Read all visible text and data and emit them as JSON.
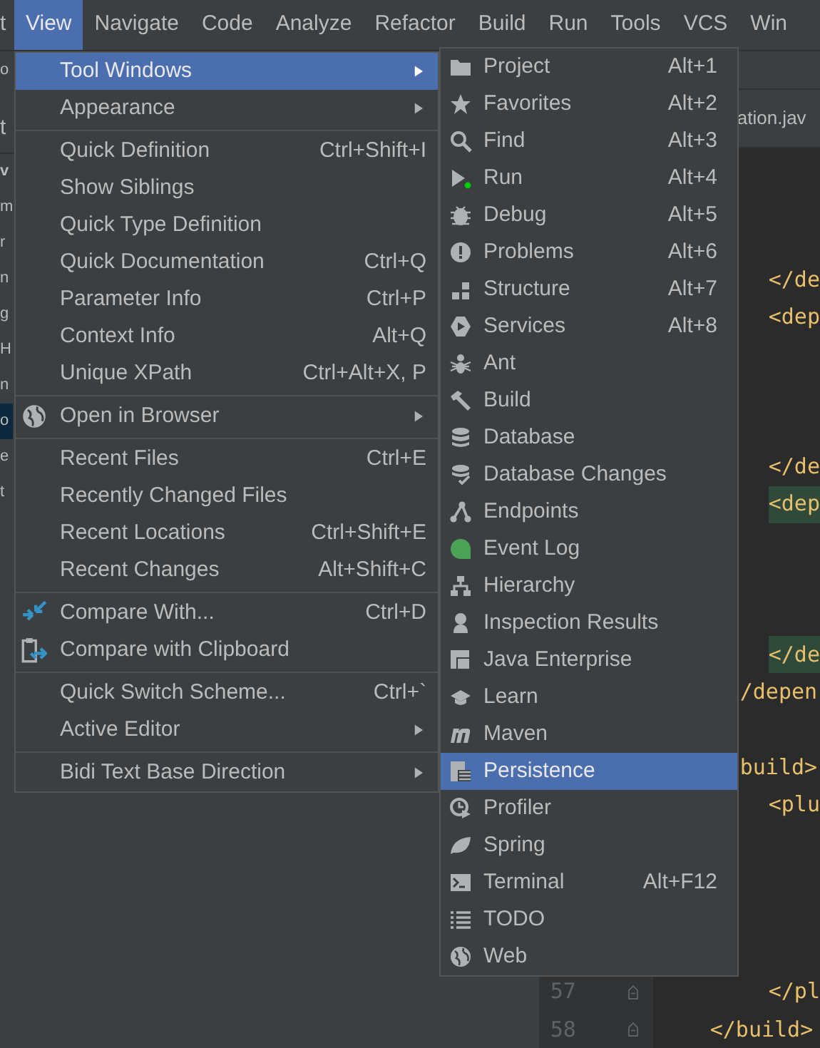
{
  "menu_bar": {
    "leading_fragment": "t",
    "items": [
      {
        "label": "View",
        "selected": true
      },
      {
        "label": "Navigate",
        "selected": false
      },
      {
        "label": "Code",
        "selected": false
      },
      {
        "label": "Analyze",
        "selected": false
      },
      {
        "label": "Refactor",
        "selected": false
      },
      {
        "label": "Build",
        "selected": false
      },
      {
        "label": "Run",
        "selected": false
      },
      {
        "label": "Tools",
        "selected": false
      },
      {
        "label": "VCS",
        "selected": false
      },
      {
        "label": "Win",
        "selected": false
      }
    ]
  },
  "project_panel": {
    "toolbar_fragment": "o",
    "tab_fragment": "t",
    "items": [
      {
        "text": "v",
        "bold": true,
        "selected": false
      },
      {
        "text": "m",
        "bold": false,
        "selected": false
      },
      {
        "text": "r",
        "bold": false,
        "selected": false
      },
      {
        "text": "n",
        "bold": false,
        "selected": false
      },
      {
        "text": "g",
        "bold": false,
        "selected": false
      },
      {
        "text": "H",
        "bold": false,
        "selected": false
      },
      {
        "text": "n",
        "bold": false,
        "selected": false
      },
      {
        "text": "o",
        "bold": false,
        "selected": true
      },
      {
        "text": "e",
        "bold": false,
        "selected": false
      },
      {
        "text": "t",
        "bold": false,
        "selected": false
      }
    ]
  },
  "editor": {
    "tab": "ation.jav",
    "lines": [
      {
        "text": "</de",
        "highlighted": false
      },
      {
        "text": "<dep",
        "highlighted": false
      },
      {
        "text": "</de",
        "highlighted": false
      },
      {
        "text": "<dep",
        "highlighted": true
      },
      {
        "text": "</de",
        "highlighted": true
      },
      {
        "text": "/depen",
        "highlighted": false
      },
      {
        "text": "build>",
        "highlighted": false
      },
      {
        "text": "<plu",
        "highlighted": false
      },
      {
        "number": "57",
        "text": "</pl",
        "highlighted": false
      },
      {
        "number": "58",
        "text": "</build>",
        "highlighted": false
      }
    ]
  },
  "view_menu": {
    "groups": [
      [
        {
          "label": "Tool Windows",
          "submenu": true,
          "selected": true
        },
        {
          "label": "Appearance",
          "submenu": true,
          "selected": false
        }
      ],
      [
        {
          "label": "Quick Definition",
          "shortcut": "Ctrl+Shift+I",
          "submenu": false,
          "selected": false
        },
        {
          "label": "Show Siblings",
          "submenu": false,
          "selected": false
        },
        {
          "label": "Quick Type Definition",
          "submenu": false,
          "selected": false
        },
        {
          "label": "Quick Documentation",
          "shortcut": "Ctrl+Q",
          "submenu": false,
          "selected": false
        },
        {
          "label": "Parameter Info",
          "shortcut": "Ctrl+P",
          "submenu": false,
          "selected": false
        },
        {
          "label": "Context Info",
          "shortcut": "Alt+Q",
          "submenu": false,
          "selected": false
        },
        {
          "label": "Unique XPath",
          "shortcut": "Ctrl+Alt+X, P",
          "submenu": false,
          "selected": false
        }
      ],
      [
        {
          "label": "Open in Browser",
          "submenu": true,
          "selected": false
        }
      ],
      [
        {
          "label": "Recent Files",
          "shortcut": "Ctrl+E",
          "submenu": false,
          "selected": false
        },
        {
          "label": "Recently Changed Files",
          "submenu": false,
          "selected": false
        },
        {
          "label": "Recent Locations",
          "shortcut": "Ctrl+Shift+E",
          "submenu": false,
          "selected": false
        },
        {
          "label": "Recent Changes",
          "shortcut": "Alt+Shift+C",
          "submenu": false,
          "selected": false
        }
      ],
      [
        {
          "label": "Compare With...",
          "shortcut": "Ctrl+D",
          "submenu": false,
          "selected": false
        },
        {
          "label": "Compare with Clipboard",
          "submenu": false,
          "selected": false
        }
      ],
      [
        {
          "label": "Quick Switch Scheme...",
          "shortcut": "Ctrl+`",
          "submenu": false,
          "selected": false
        },
        {
          "label": "Active Editor",
          "submenu": true,
          "selected": false
        }
      ],
      [
        {
          "label": "Bidi Text Base Direction",
          "submenu": true,
          "selected": false
        }
      ]
    ]
  },
  "tool_windows_menu": {
    "items": [
      {
        "label": "Project",
        "shortcut": "Alt+1",
        "selected": false
      },
      {
        "label": "Favorites",
        "shortcut": "Alt+2",
        "selected": false
      },
      {
        "label": "Find",
        "shortcut": "Alt+3",
        "selected": false
      },
      {
        "label": "Run",
        "shortcut": "Alt+4",
        "selected": false
      },
      {
        "label": "Debug",
        "shortcut": "Alt+5",
        "selected": false
      },
      {
        "label": "Problems",
        "shortcut": "Alt+6",
        "selected": false
      },
      {
        "label": "Structure",
        "shortcut": "Alt+7",
        "selected": false
      },
      {
        "label": "Services",
        "shortcut": "Alt+8",
        "selected": false
      },
      {
        "label": "Ant",
        "selected": false
      },
      {
        "label": "Build",
        "selected": false
      },
      {
        "label": "Database",
        "selected": false
      },
      {
        "label": "Database Changes",
        "selected": false
      },
      {
        "label": "Endpoints",
        "selected": false
      },
      {
        "label": "Event Log",
        "selected": false
      },
      {
        "label": "Hierarchy",
        "selected": false
      },
      {
        "label": "Inspection Results",
        "selected": false
      },
      {
        "label": "Java Enterprise",
        "selected": false
      },
      {
        "label": "Learn",
        "selected": false
      },
      {
        "label": "Maven",
        "selected": false
      },
      {
        "label": "Persistence",
        "selected": true
      },
      {
        "label": "Profiler",
        "selected": false
      },
      {
        "label": "Spring",
        "selected": false
      },
      {
        "label": "Terminal",
        "shortcut": "Alt+F12",
        "selected": false
      },
      {
        "label": "TODO",
        "selected": false
      },
      {
        "label": "Web",
        "selected": false
      }
    ]
  }
}
